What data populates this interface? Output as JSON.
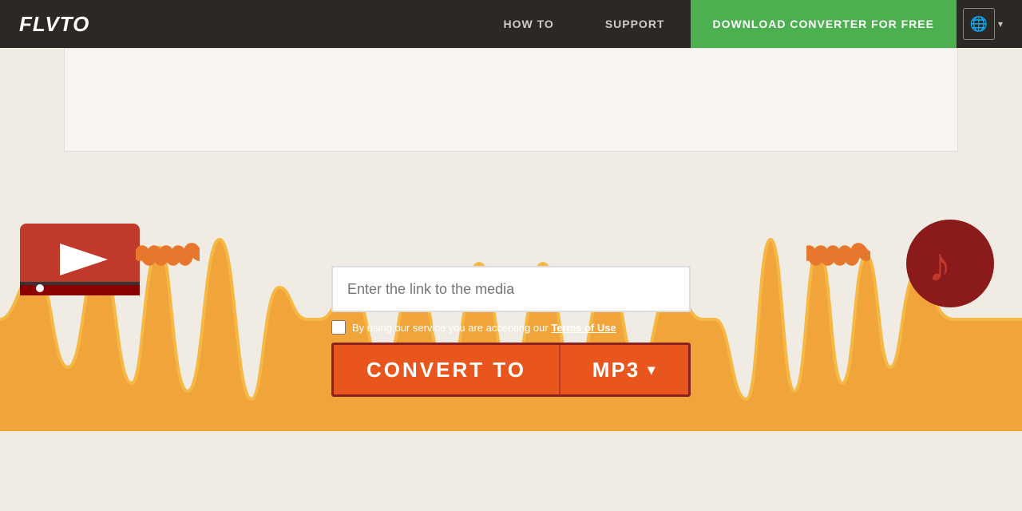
{
  "header": {
    "logo": "FLVTO",
    "nav": {
      "how_to": "HOW TO",
      "support": "SUPPORT",
      "download_bold": "DOWNLOAD",
      "download_rest": " CONVERTER FOR FREE"
    },
    "lang_icon": "🌐",
    "lang_chevron": "▾"
  },
  "main": {
    "input_placeholder": "Enter the link to the media",
    "terms_text": "By using our service you are accepting our ",
    "terms_link": "Terms of Use",
    "convert_label": "CONVERT TO",
    "convert_format": "MP3",
    "convert_chevron": "▾"
  }
}
